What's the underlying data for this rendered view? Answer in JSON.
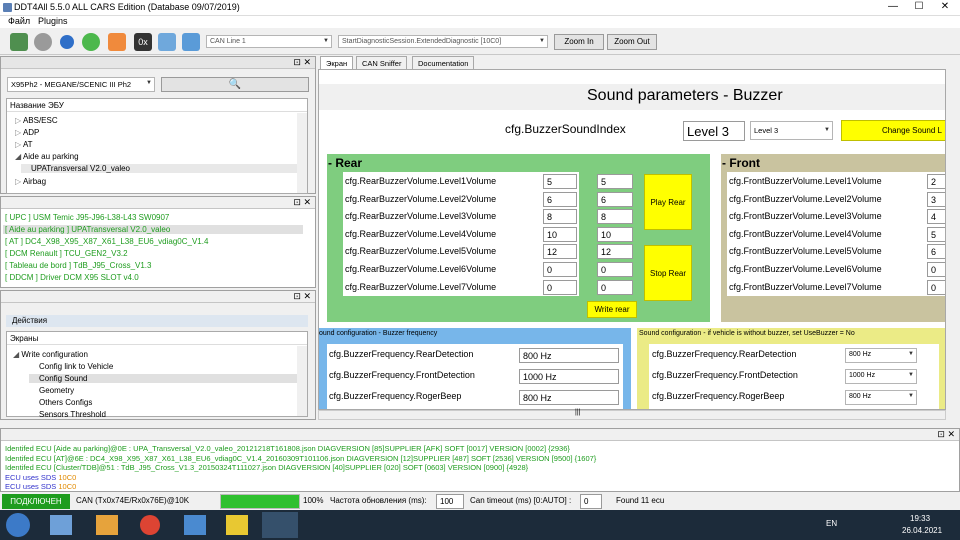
{
  "window": {
    "title": "DDT4All 5.5.0 ALL CARS Edition (Database 09/07/2019)",
    "controls": [
      "—",
      "☐",
      "✕"
    ]
  },
  "menu": [
    "Файл",
    "Plugins"
  ],
  "toolbar": {
    "can_line": "CAN Line 1",
    "session": "StartDiagnosticSession.ExtendedDiagnostic [10C0]",
    "zoom_in": "Zoom In",
    "zoom_out": "Zoom Out",
    "hex_label": "0x"
  },
  "ecu_panel": {
    "vehicle": "X95Ph2 - MEGANE/SCENIC III Ph2",
    "header": "Название ЭБУ",
    "items": [
      "ABS/ESC",
      "ADP",
      "AT",
      "Aide au parking",
      "UPATransversal V2.0_valeo",
      "Airbag"
    ]
  },
  "ecu_list": [
    "[ UPC ] USM Temic J95-J96-L38-L43 SW0907",
    "[ Aide au parking ] UPATransversal V2.0_valeo",
    "[ AT ] DC4_X98_X95_X87_X61_L38_EU6_vdiag0C_V1.4",
    "[ DCM Renault ] TCU_GEN2_V3.2",
    "[ Tableau de bord ] TdB_J95_Cross_V1.3",
    "[ DDCM ] Driver DCM X95 SLOT v4.0"
  ],
  "actions": {
    "tab": "Действия",
    "screens_header": "Экраны",
    "tree": [
      "Write configuration",
      "Config link to Vehicle",
      "Config Sound",
      "Geometry",
      "Others Configs",
      "Sensors Threshold"
    ]
  },
  "tabs": [
    "Экран",
    "CAN Sniffer",
    "Documentation"
  ],
  "screen": {
    "title": "Sound parameters - Buzzer",
    "index_label": "cfg.BuzzerSoundIndex",
    "index_value": "Level 3",
    "index_select": "Level 3",
    "change_button": "Change Sound L",
    "rear": {
      "title": "- Rear",
      "rows": [
        {
          "label": "cfg.RearBuzzerVolume.Level1Volume",
          "v1": "5",
          "v2": "5"
        },
        {
          "label": "cfg.RearBuzzerVolume.Level2Volume",
          "v1": "6",
          "v2": "6"
        },
        {
          "label": "cfg.RearBuzzerVolume.Level3Volume",
          "v1": "8",
          "v2": "8"
        },
        {
          "label": "cfg.RearBuzzerVolume.Level4Volume",
          "v1": "10",
          "v2": "10"
        },
        {
          "label": "cfg.RearBuzzerVolume.Level5Volume",
          "v1": "12",
          "v2": "12"
        },
        {
          "label": "cfg.RearBuzzerVolume.Level6Volume",
          "v1": "0",
          "v2": "0"
        },
        {
          "label": "cfg.RearBuzzerVolume.Level7Volume",
          "v1": "0",
          "v2": "0"
        }
      ],
      "play": "Play Rear",
      "stop": "Stop Rear",
      "write": "Write rear"
    },
    "front": {
      "title": "- Front",
      "rows": [
        {
          "label": "cfg.FrontBuzzerVolume.Level1Volume",
          "v": "2"
        },
        {
          "label": "cfg.FrontBuzzerVolume.Level2Volume",
          "v": "3"
        },
        {
          "label": "cfg.FrontBuzzerVolume.Level3Volume",
          "v": "4"
        },
        {
          "label": "cfg.FrontBuzzerVolume.Level4Volume",
          "v": "5"
        },
        {
          "label": "cfg.FrontBuzzerVolume.Level5Volume",
          "v": "6"
        },
        {
          "label": "cfg.FrontBuzzerVolume.Level6Volume",
          "v": "0"
        },
        {
          "label": "cfg.FrontBuzzerVolume.Level7Volume",
          "v": "0"
        }
      ]
    },
    "freq_left": {
      "title": "ound configuration - Buzzer frequency",
      "rows": [
        {
          "label": "cfg.BuzzerFrequency.RearDetection",
          "v": "800 Hz"
        },
        {
          "label": "cfg.BuzzerFrequency.FrontDetection",
          "v": "1000 Hz"
        },
        {
          "label": "cfg.BuzzerFrequency.RogerBeep",
          "v": "800 Hz"
        }
      ]
    },
    "freq_right": {
      "title": "Sound configuration - if vehicle is without buzzer, set UseBuzzer = No",
      "rows": [
        {
          "label": "cfg.BuzzerFrequency.RearDetection",
          "v": "800 Hz"
        },
        {
          "label": "cfg.BuzzerFrequency.FrontDetection",
          "v": "1000 Hz"
        },
        {
          "label": "cfg.BuzzerFrequency.RogerBeep",
          "v": "800 Hz"
        }
      ]
    }
  },
  "log": [
    {
      "text": "Identifed ECU [Aide au parking]@0E : UPA_Transversal_V2.0_valeo_20121218T161808.json DIAGVERSION [85]SUPPLIER [AFK] SOFT [0017] VERSION [0002] {2936}",
      "color": "#1e9c1e"
    },
    {
      "text": "Identifed ECU [AT]@6E : DC4_X98_X95_X87_X61_L38_EU6_vdiag0C_V1.4_20160309T101106.json DIAGVERSION [12]SUPPLIER [487] SOFT [2536] VERSION [9500] {1607}",
      "color": "#1e9c1e"
    },
    {
      "text": "Identifed ECU [Cluster/TDB]@51 : TdB_J95_Cross_V1.3_20150324T111027.json DIAGVERSION [40]SUPPLIER [020] SOFT [0603] VERSION [0900] {4928}",
      "color": "#1e9c1e"
    },
    {
      "text": "ECU uses SDS ",
      "color": "#3333cc",
      "extra": "10C0"
    },
    {
      "text": "ECU uses SDS ",
      "color": "#3333cc",
      "extra": "10C0"
    }
  ],
  "status": {
    "connected": "ПОДКЛЮЧЕН",
    "can": "CAN (Tx0x74E/Rx0x76E)@10K",
    "progress": "100%",
    "progress_value": 1.0,
    "refresh_label": "Частота обновления (ms):",
    "refresh_value": "100",
    "timeout_label": "Can timeout (ms) [0:AUTO] :",
    "timeout_value": "0",
    "found": "Found 11 ecu"
  },
  "taskbar": {
    "lang": "EN",
    "time": "19:33",
    "date": "26.04.2021"
  }
}
